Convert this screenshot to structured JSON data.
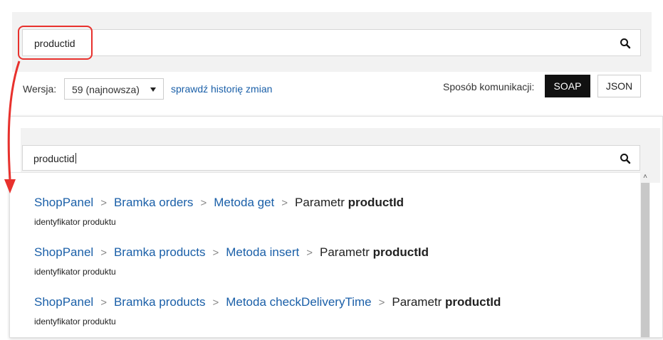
{
  "search": {
    "value": "productid"
  },
  "version": {
    "label": "Wersja:",
    "selected": "59 (najnowsza)",
    "history_link": "sprawdź historię zmian"
  },
  "communication": {
    "label": "Sposób komunikacji:",
    "options": [
      "SOAP",
      "JSON"
    ],
    "active": "SOAP"
  },
  "zoom": {
    "search_value": "productid",
    "results": [
      {
        "crumbs": [
          "ShopPanel",
          "Bramka orders",
          "Metoda get"
        ],
        "param_prefix": "Parametr ",
        "param_name": "productId",
        "description": "identyfikator produktu"
      },
      {
        "crumbs": [
          "ShopPanel",
          "Bramka products",
          "Metoda insert"
        ],
        "param_prefix": "Parametr ",
        "param_name": "productId",
        "description": "identyfikator produktu"
      },
      {
        "crumbs": [
          "ShopPanel",
          "Bramka products",
          "Metoda checkDeliveryTime"
        ],
        "param_prefix": "Parametr ",
        "param_name": "productId",
        "description": "identyfikator produktu"
      }
    ]
  },
  "colors": {
    "link": "#1a5fa8",
    "highlight": "#e8312d",
    "active_button": "#111111"
  },
  "icons": [
    "search-icon",
    "chevron-right-icon",
    "caret-down-icon",
    "scroll-up-icon",
    "arrow-icon"
  ]
}
